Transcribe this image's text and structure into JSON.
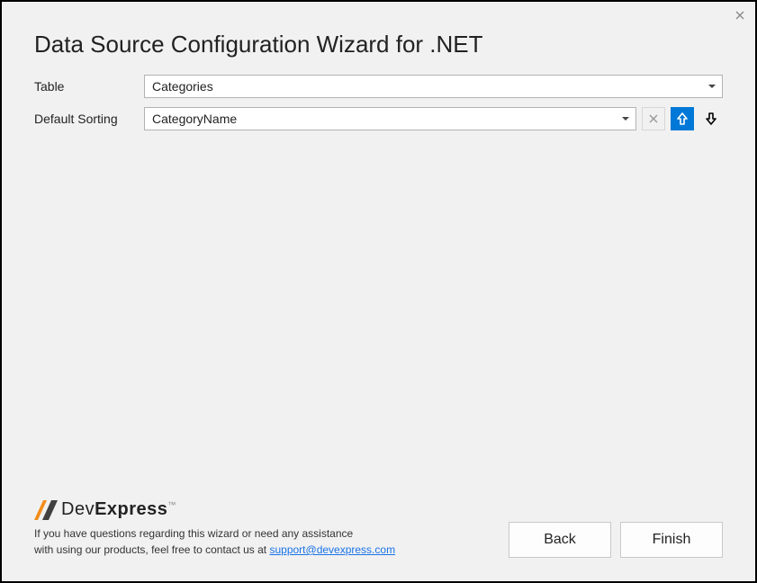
{
  "window": {
    "title": "Data Source Configuration Wizard for .NET"
  },
  "form": {
    "table": {
      "label": "Table",
      "value": "Categories"
    },
    "sorting": {
      "label": "Default Sorting",
      "value": "CategoryName"
    }
  },
  "footer": {
    "brand_dev": "Dev",
    "brand_express": "Express",
    "brand_tm": "™",
    "help_line1": "If you have questions regarding this wizard or need any assistance",
    "help_line2_prefix": "with using our products, feel free to contact us at ",
    "support_link_text": "support@devexpress.com"
  },
  "buttons": {
    "back": "Back",
    "finish": "Finish"
  }
}
